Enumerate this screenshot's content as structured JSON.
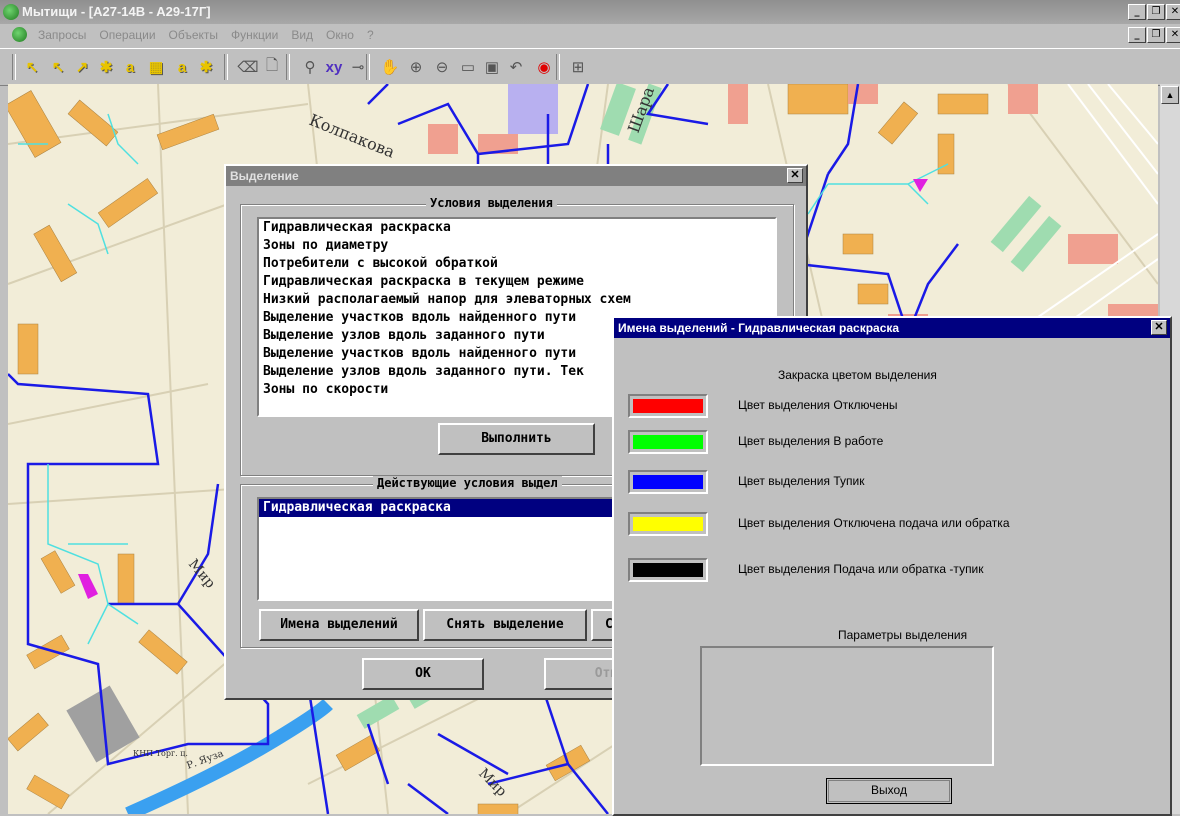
{
  "window": {
    "title": "Мытищи - [A27-14B - A29-17Г]"
  },
  "menu": {
    "items": [
      "Запросы",
      "Операции",
      "Объекты",
      "Функции",
      "Вид",
      "Окно",
      "?"
    ]
  },
  "toolbar": {
    "buttons": [
      {
        "icon": "select-node-icon",
        "glyph": "↖"
      },
      {
        "icon": "select-nodes-icon",
        "glyph": "↖"
      },
      {
        "icon": "select-edge-icon",
        "glyph": "↗"
      },
      {
        "icon": "select-star-icon",
        "glyph": "✱"
      },
      {
        "icon": "select-text-icon",
        "glyph": "a"
      },
      {
        "icon": "select-rect-icon",
        "glyph": "▦"
      },
      {
        "icon": "select-label-icon",
        "glyph": "a"
      },
      {
        "icon": "select-multi-icon",
        "glyph": "✱"
      },
      {
        "icon": "eraser-icon",
        "glyph": "⌫"
      },
      {
        "icon": "new-doc-icon",
        "glyph": "🗋"
      },
      {
        "icon": "binoculars-icon",
        "glyph": "⚲"
      },
      {
        "icon": "xy-icon",
        "glyph": "xy"
      },
      {
        "icon": "measure-icon",
        "glyph": "⊸"
      },
      {
        "icon": "pan-hand-icon",
        "glyph": "✋"
      },
      {
        "icon": "zoom-in-icon",
        "glyph": "⊕"
      },
      {
        "icon": "zoom-out-icon",
        "glyph": "⊖"
      },
      {
        "icon": "zoom-window-icon",
        "glyph": "▭"
      },
      {
        "icon": "zoom-extent-icon",
        "glyph": "▣"
      },
      {
        "icon": "undo-icon",
        "glyph": "↶"
      },
      {
        "icon": "target-icon",
        "glyph": "◉"
      },
      {
        "icon": "layers-icon",
        "glyph": "⊞"
      }
    ]
  },
  "map": {
    "labels": [
      "Колпакова",
      "Шара",
      "Мир",
      "Мир",
      "Р. Яуза",
      "КНП Торг. ц."
    ],
    "colors": {
      "background": "#f2edd8",
      "pipe": "#1a1ae6",
      "water_pipe": "#4fe0e0",
      "building": "#f0b050",
      "building_red": "#f0a090",
      "building_green": "#9fdcb0",
      "river": "#3aa0f0",
      "road": "#d8d0b4"
    }
  },
  "selection_dialog": {
    "title": "Выделение",
    "conditions_label": "Условия выделения",
    "conditions": [
      "Гидравлическая раскраска",
      "Зоны по диаметру",
      "Потребители с высокой обраткой",
      "Гидравлическая раскраска в текущем режиме",
      "Низкий располагаемый напор для элеваторных схем",
      "Выделение участков вдоль найденного пути",
      "Выделение узлов вдоль заданного пути",
      "Выделение участков вдоль найденного пути",
      "Выделение узлов вдоль заданного пути. Тек",
      "Зоны по скорости"
    ],
    "execute_label": "Выполнить",
    "active_label": "Действующие условия выдел",
    "active_items": [
      "Гидравлическая раскраска"
    ],
    "names_button": "Имена выделений",
    "clear_button": "Снять выделение",
    "third_button": "С",
    "ok_button": "OK",
    "cancel_button": "Отме"
  },
  "names_dialog": {
    "title": "Имена выделений - Гидравлическая раскраска",
    "fill_label": "Закраска цветом выделения",
    "entries": [
      {
        "label": "Цвет выделения  Отключены",
        "color": "#ff0000"
      },
      {
        "label": "Цвет выделения  В работе",
        "color": "#00ff00"
      },
      {
        "label": "Цвет выделения  Тупик",
        "color": "#0000ff"
      },
      {
        "label": "Цвет выделения  Отключена подача или обратка",
        "color": "#ffff00"
      },
      {
        "label": "Цвет выделения  Подача или обратка -тупик",
        "color": "#000000"
      }
    ],
    "params_label": "Параметры выделения",
    "exit_button": "Выход"
  }
}
